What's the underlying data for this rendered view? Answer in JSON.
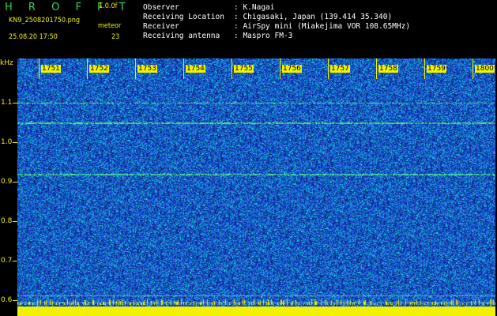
{
  "header": {
    "logo": "H R O F F T",
    "version": "1.0.0f",
    "filename": "KN9_2508201750.png",
    "datetime": "25.08.20 17:50",
    "mode_label": "meteor",
    "count": "23"
  },
  "info": {
    "observer_label": "Observer",
    "observer_value": ": K.Nagai",
    "location_label": "Receiving Location",
    "location_value": ": Chigasaki, Japan (139.414 35.340)",
    "receiver_label": "Receiver",
    "receiver_value": ": AirSpy mini (Miakejima VOR 108.65MHz)",
    "antenna_label": "Receiving antenna",
    "antenna_value": ": Maspro FM-3"
  },
  "axes": {
    "y_unit": "kHz",
    "y_ticks": [
      "1.1",
      "1.0",
      "0.9",
      "0.8",
      "0.7",
      "0.6"
    ],
    "y_tick_values": [
      1.1,
      1.0,
      0.9,
      0.8,
      0.7,
      0.6
    ],
    "y_range": [
      0.56,
      1.2
    ],
    "time_ticks": [
      "1751",
      "1752",
      "1753",
      "1754",
      "1755",
      "1756",
      "1757",
      "1758",
      "1759",
      "1800"
    ]
  },
  "colors": {
    "background": "#000000",
    "axis": "#f2f200",
    "spectrogram_base": "#1a2f9c",
    "spectrogram_noise": "#1e6fd8",
    "spectrogram_hot": "#25d2b0",
    "carrier_line": "#44ee88"
  }
}
